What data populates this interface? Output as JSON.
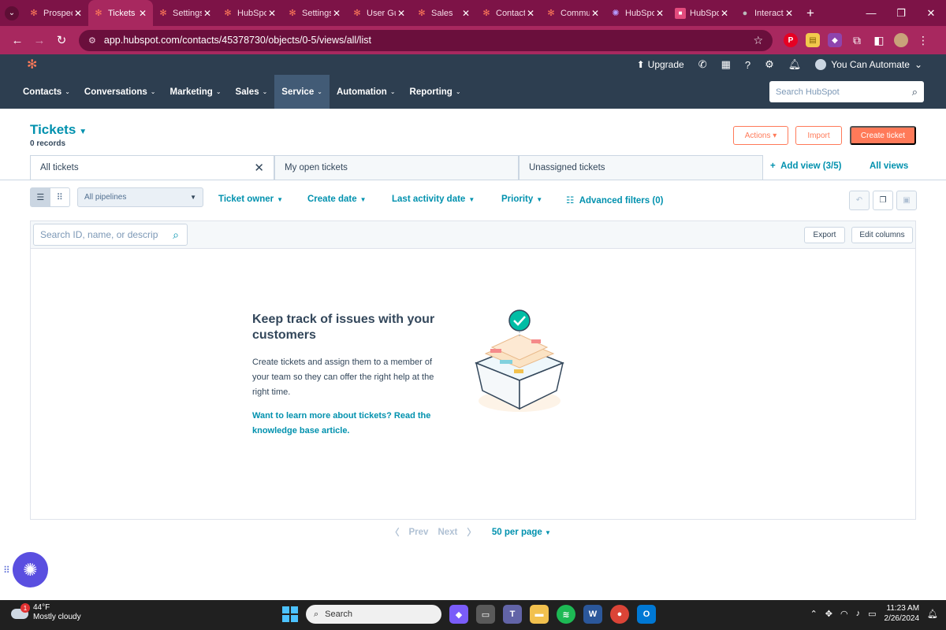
{
  "browser": {
    "tabs": [
      {
        "label": "Prospects",
        "icon": "hubspot-icon"
      },
      {
        "label": "Tickets",
        "icon": "hubspot-icon",
        "active": true
      },
      {
        "label": "Settings",
        "icon": "hubspot-icon"
      },
      {
        "label": "HubSpot",
        "icon": "hubspot-icon"
      },
      {
        "label": "Settings",
        "icon": "hubspot-icon"
      },
      {
        "label": "User Guide",
        "icon": "hubspot-icon"
      },
      {
        "label": "Sales",
        "icon": "hubspot-icon"
      },
      {
        "label": "Contacts",
        "icon": "hubspot-icon"
      },
      {
        "label": "Community",
        "icon": "hubspot-icon"
      },
      {
        "label": "HubSpot",
        "icon": "purple-gear-icon"
      },
      {
        "label": "HubSpot",
        "icon": "app-box-icon"
      },
      {
        "label": "Interact",
        "icon": "globe-icon"
      }
    ],
    "url": "app.hubspot.com/contacts/45378730/objects/0-5/views/all/list"
  },
  "hubspot": {
    "utility": {
      "upgrade": "Upgrade",
      "account": "You Can Automate"
    },
    "nav": [
      {
        "label": "Contacts"
      },
      {
        "label": "Conversations"
      },
      {
        "label": "Marketing"
      },
      {
        "label": "Sales"
      },
      {
        "label": "Service",
        "active": true
      },
      {
        "label": "Automation"
      },
      {
        "label": "Reporting"
      }
    ],
    "search_placeholder": "Search HubSpot"
  },
  "page": {
    "title": "Tickets",
    "record_count": "0 records",
    "actions_label": "Actions",
    "import_label": "Import",
    "create_label": "Create ticket"
  },
  "views": {
    "tabs": [
      "All tickets",
      "My open tickets",
      "Unassigned tickets"
    ],
    "add_view": "Add view (3/5)",
    "all_views": "All views"
  },
  "filters": {
    "pipeline": "All pipelines",
    "items": [
      "Ticket owner",
      "Create date",
      "Last activity date",
      "Priority"
    ],
    "advanced": "Advanced filters (0)"
  },
  "table": {
    "search_placeholder": "Search ID, name, or description",
    "export_label": "Export",
    "edit_columns_label": "Edit columns"
  },
  "empty_state": {
    "title": "Keep track of issues with your customers",
    "description": "Create tickets and assign them to a member of your team so they can offer the right help at the right time.",
    "link": "Want to learn more about tickets? Read the knowledge base article."
  },
  "pagination": {
    "prev": "Prev",
    "next": "Next",
    "per_page": "50 per page"
  },
  "taskbar": {
    "temperature": "44°F",
    "weather": "Mostly cloudy",
    "weather_badge": "1",
    "search_label": "Search",
    "time": "11:23 AM",
    "date": "2/26/2024"
  },
  "colors": {
    "brand_orange": "#ff7a59",
    "link_teal": "#0091ae",
    "nav_bg": "#2d3e50",
    "browser_chrome": "#a8285f"
  }
}
